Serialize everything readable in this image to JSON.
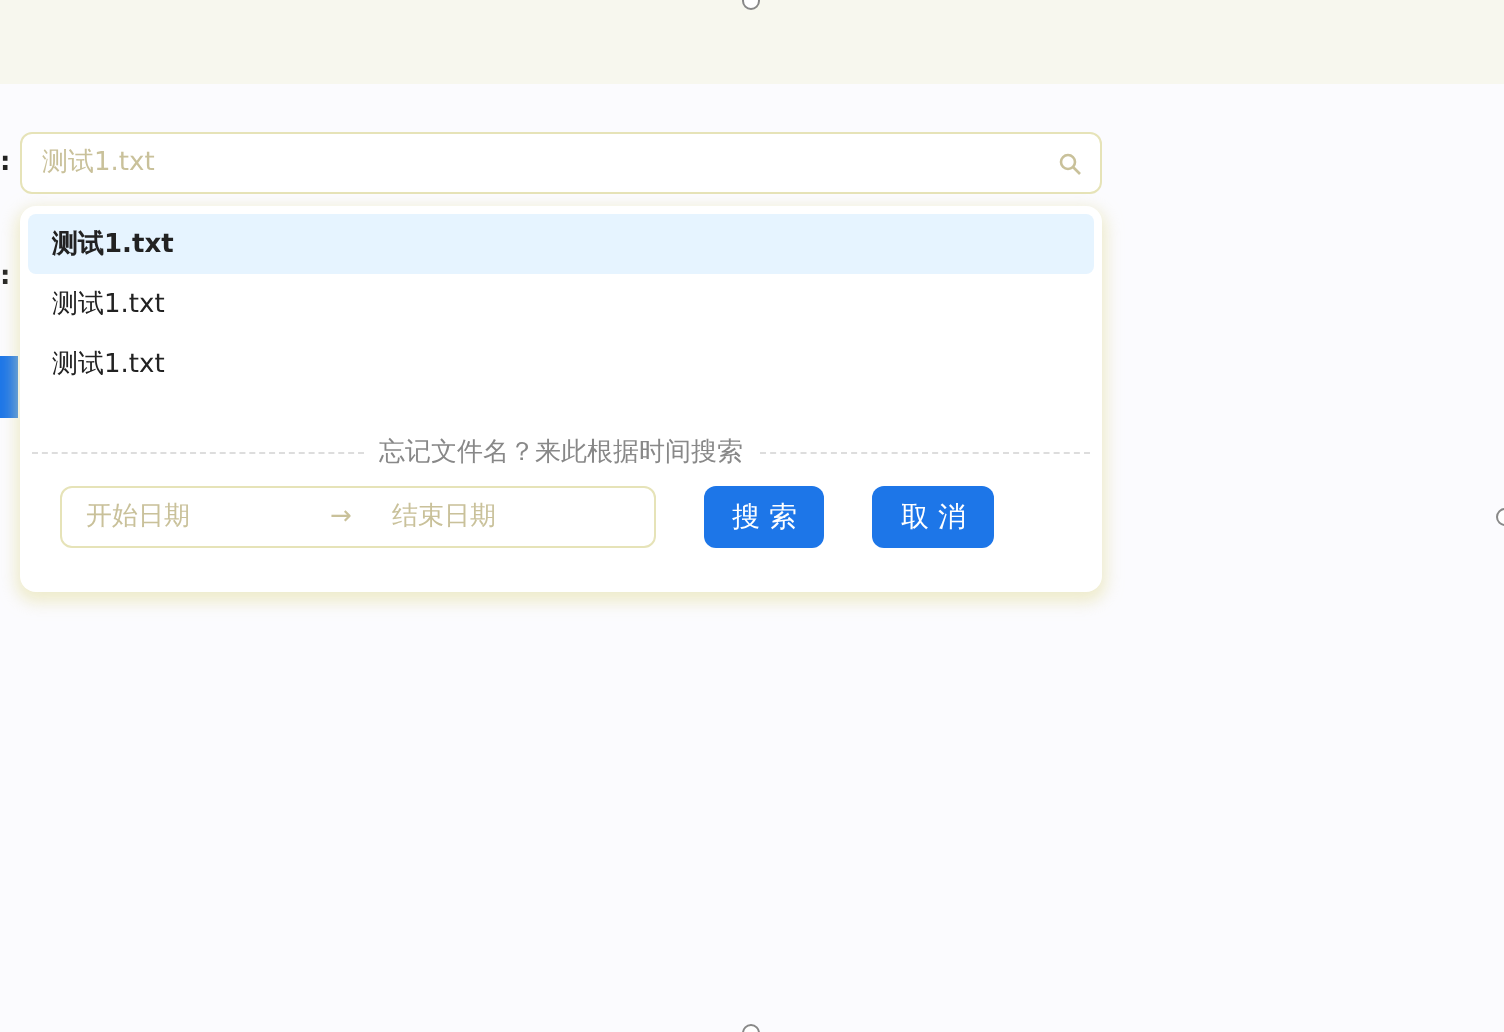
{
  "labels": [
    ":",
    ":"
  ],
  "search": {
    "placeholder": "测试1.txt"
  },
  "options": [
    {
      "label": "测试1.txt",
      "selected": true
    },
    {
      "label": "测试1.txt",
      "selected": false
    },
    {
      "label": "测试1.txt",
      "selected": false
    }
  ],
  "divider_text": "忘记文件名？来此根据时间搜索",
  "date_range": {
    "start_placeholder": "开始日期",
    "separator": "→",
    "end_placeholder": "结束日期"
  },
  "buttons": [
    "搜 索",
    "取 消"
  ]
}
